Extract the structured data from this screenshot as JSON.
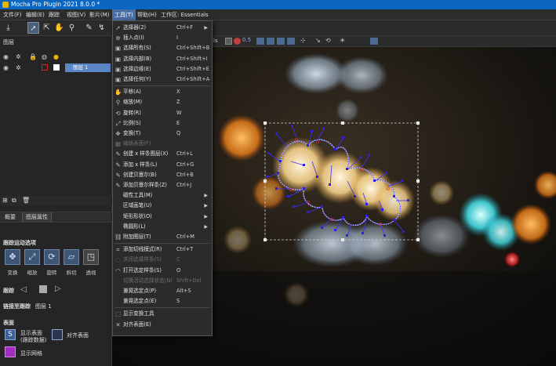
{
  "window": {
    "title": "Mocha Pro Plugin 2021 8.0.0 *"
  },
  "menubar": {
    "items": [
      {
        "label": "文件(F)"
      },
      {
        "label": "编辑(E)"
      },
      {
        "label": "跟踪"
      },
      {
        "label": "视图(V)"
      },
      {
        "label": "影片(M)"
      },
      {
        "label": "工具(T)"
      },
      {
        "label": "帮助(H)"
      },
      {
        "label": "工作区: Essentials"
      }
    ]
  },
  "left_panel": {
    "layers_title": "图层",
    "layer_name": "图层 1",
    "tabs": [
      "概要",
      "图层属性"
    ],
    "motion_title": "跟踪运动选项",
    "motion_buttons": [
      "变换",
      "缩放",
      "旋转",
      "斜切",
      "透视"
    ],
    "track_label": "跟踪",
    "link_label": "链接至跟踪",
    "link_value": "图层 1",
    "surface_title": "表面",
    "show_surface": "显示表面",
    "track_data": "(跟踪数据)",
    "align_surface": "对齐表面",
    "show_grid": "显示网格"
  },
  "canvas_toolbar": {
    "zoom_value": "0.5",
    "view_label": "ls"
  },
  "tools_menu": {
    "items": [
      {
        "label": "选择器(2)",
        "shortcut": "Ctrl+F",
        "submenu": true,
        "icon": "cursor-icon"
      },
      {
        "label": "插入点(I)",
        "shortcut": "I",
        "icon": "insert-point-icon"
      },
      {
        "label": "选择所有(S)",
        "shortcut": "Ctrl+Shift+B",
        "icon": "select-all-icon"
      },
      {
        "label": "选择内部(B)",
        "shortcut": "Ctrl+Shift+I",
        "icon": "select-inner-icon"
      },
      {
        "label": "选择边缘(E)",
        "shortcut": "Ctrl+Shift+E",
        "icon": "select-edge-icon"
      },
      {
        "label": "选择任何(Y)",
        "shortcut": "Ctrl+Shift+A",
        "icon": "select-any-icon"
      },
      {
        "sep": true
      },
      {
        "label": "平移(A)",
        "shortcut": "X",
        "icon": "pan-hand-icon"
      },
      {
        "label": "缩放(M)",
        "shortcut": "Z",
        "icon": "zoom-icon"
      },
      {
        "label": "旋转(R)",
        "shortcut": "W",
        "icon": "rotate-icon"
      },
      {
        "label": "比例(S)",
        "shortcut": "E",
        "icon": "scale-icon"
      },
      {
        "label": "变换(T)",
        "shortcut": "Q",
        "icon": "transform-icon"
      },
      {
        "label": "编辑表面(F)",
        "shortcut": "",
        "disabled": true,
        "icon": "edit-surface-icon"
      },
      {
        "label": "创建 x 样条图层(X)",
        "shortcut": "Ctrl+L",
        "icon": "create-x-spline-icon"
      },
      {
        "label": "添加 x 样条(L)",
        "shortcut": "Ctrl+G",
        "icon": "add-x-spline-icon"
      },
      {
        "label": "创建贝塞尔(B)",
        "shortcut": "Ctrl+B",
        "icon": "create-bezier-icon"
      },
      {
        "label": "添加贝塞尔样条(Z)",
        "shortcut": "Ctrl+J",
        "icon": "add-bezier-icon"
      },
      {
        "label": "磁性工具(M)",
        "shortcut": "",
        "submenu": true,
        "icon": "magnetic-icon"
      },
      {
        "label": "区域画笔(U)",
        "shortcut": "",
        "submenu": true,
        "icon": "area-brush-icon"
      },
      {
        "label": "矩形形状(O)",
        "shortcut": "",
        "submenu": true,
        "icon": "rect-shape-icon"
      },
      {
        "label": "椭圆形(L)",
        "shortcut": "",
        "submenu": true,
        "icon": "ellipse-icon"
      },
      {
        "label": "附加图层(T)",
        "shortcut": "Ctrl+M",
        "icon": "attach-layer-icon"
      },
      {
        "sep": true
      },
      {
        "label": "添加切线模式(R)",
        "shortcut": "Ctrl+T",
        "icon": "tangent-mode-icon"
      },
      {
        "label": "关闭选择样条(S)",
        "shortcut": "C",
        "disabled": true,
        "icon": "close-spline-icon"
      },
      {
        "label": "打开选定样条(S)",
        "shortcut": "O",
        "icon": "open-spline-icon"
      },
      {
        "label": "切换活动选择状态(N)",
        "shortcut": "Shift+Del",
        "disabled": true,
        "icon": "toggle-active-icon"
      },
      {
        "label": "兼晃选定点(P)",
        "shortcut": "Alt+S",
        "icon": "jitter-point-icon"
      },
      {
        "label": "兼晃选定点(E)",
        "shortcut": "S",
        "icon": "jitter-point2-icon"
      },
      {
        "sep": true
      },
      {
        "label": "显示变换工具",
        "shortcut": "",
        "icon": "show-transform-icon"
      },
      {
        "label": "对齐表面(E)",
        "shortcut": "",
        "icon": "align-surface-icon"
      }
    ]
  },
  "colors": {
    "title_bar": "#0b66c2",
    "menu_active": "#4a6fa5",
    "spline": "#2a1ff0",
    "spline_outline": "#e1e8ff"
  }
}
